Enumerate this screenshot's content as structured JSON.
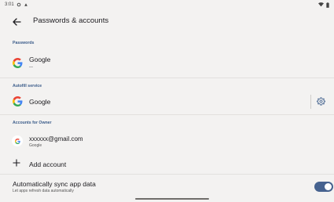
{
  "status_bar": {
    "time": "3:01"
  },
  "header": {
    "title": "Passwords & accounts"
  },
  "passwords": {
    "section_label": "Passwords",
    "provider": {
      "name": "Google",
      "subtitle": "—"
    }
  },
  "autofill": {
    "section_label": "Autofill service",
    "provider": {
      "name": "Google"
    }
  },
  "accounts": {
    "section_label": "Accounts for Owner",
    "items": [
      {
        "email": "xxxxxx@gmail.com",
        "type": "Google"
      }
    ],
    "add_label": "Add account"
  },
  "sync": {
    "title": "Automatically sync app data",
    "subtitle": "Let apps refresh data automatically",
    "enabled": true
  },
  "colors": {
    "accent": "#46628f",
    "section_header": "#3b5c8a",
    "background": "#f3f2f1"
  },
  "icons": [
    "back-arrow-icon",
    "google-icon",
    "settings-gear-icon",
    "plus-icon",
    "toggle-switch"
  ]
}
